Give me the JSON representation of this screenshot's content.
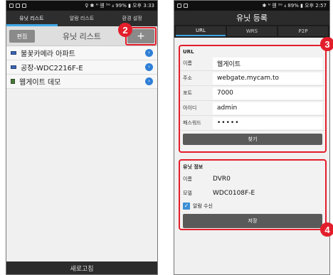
{
  "left_phone": {
    "status": {
      "right_text": "♀ ✱ ᴺ 웬 ⁵ᴳ ₄ 99% ▮ 오후 3:33"
    },
    "tabs": [
      {
        "label": "유닛 리스트",
        "active": true
      },
      {
        "label": "알람 리스트",
        "active": false
      },
      {
        "label": "환경 설정",
        "active": false
      }
    ],
    "header": {
      "edit_label": "편집",
      "title": "유닛 리스트",
      "add_label": "+"
    },
    "sites": [
      {
        "name": "불꽃카메라 아파트",
        "icon": "camera-icon"
      },
      {
        "name": "공장-WDC2216F-E",
        "icon": "camera-icon"
      },
      {
        "name": "웹게이트 데모",
        "icon": "document-icon"
      }
    ],
    "refresh_label": "새로고침"
  },
  "right_phone": {
    "status": {
      "right_text": "✱ ᴺ 웬 ⁵ᴳ ₄ 89% ▮ 오후 2:57"
    },
    "title": "유닛 등록",
    "segments": [
      {
        "label": "URL",
        "active": true
      },
      {
        "label": "WRS",
        "active": false
      },
      {
        "label": "P2P",
        "active": false
      }
    ],
    "url_panel": {
      "title": "URL",
      "fields": [
        {
          "label": "이름",
          "value": "웹게이트"
        },
        {
          "label": "주소",
          "value": "webgate.mycam.to"
        },
        {
          "label": "포트",
          "value": "7000"
        },
        {
          "label": "아이디",
          "value": "admin"
        },
        {
          "label": "패스워드",
          "value": "•••••"
        }
      ],
      "search_label": "찾기"
    },
    "info_panel": {
      "title": "유닛 정보",
      "rows": [
        {
          "label": "이름",
          "value": "DVR0"
        },
        {
          "label": "모델",
          "value": "WDC0108F-E"
        }
      ],
      "alarm_label": "알람 수신",
      "alarm_checked": true,
      "save_label": "저장"
    }
  },
  "callouts": [
    "2",
    "3",
    "4"
  ],
  "colors": {
    "accent": "#3fa7e6",
    "callout": "#e31e2b"
  }
}
